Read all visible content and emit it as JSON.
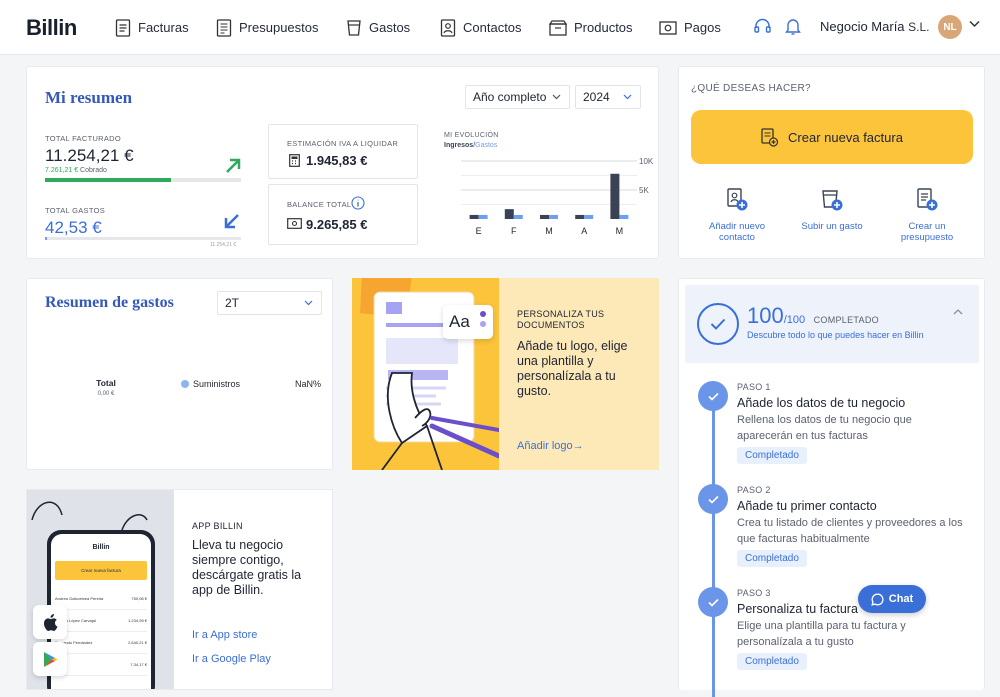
{
  "topbar": {
    "logo": "Billin",
    "nav": [
      "Facturas",
      "Presupuestos",
      "Gastos",
      "Contactos",
      "Productos",
      "Pagos"
    ],
    "company": "Negocio María",
    "company_suffix": "S.L.",
    "avatar": "NL",
    "icons": [
      "headset-icon",
      "bell-icon",
      "chevron-down-icon"
    ]
  },
  "summary": {
    "title": "Mi resumen",
    "period_select": "Año completo",
    "year_select": "2024",
    "total_facturado_label": "TOTAL FACTURADO",
    "total_facturado": "11.254,21 €",
    "cobrado_amount": "7.261,21 €",
    "cobrado_label": "Cobrado",
    "cobrado_fraction": 0.645,
    "total_gastos_label": "TOTAL GASTOS",
    "total_gastos": "42,53 €",
    "gastos_small": "11.254,21 €",
    "iva_label": "ESTIMACIÓN IVA A LIQUIDAR",
    "iva": "1.945,83 €",
    "balance_label": "BALANCE TOTAL",
    "balance": "9.265,85 €",
    "evolucion_label": "MI EVOLUCIÓN",
    "ingresos_label": "Ingresos",
    "gastos_legend": "Gastos"
  },
  "chart_data": {
    "type": "bar",
    "categories": [
      "E",
      "F",
      "M",
      "A",
      "M"
    ],
    "y_ticks": [
      "10K",
      "5K"
    ],
    "ylim": [
      0,
      10000
    ],
    "series": [
      {
        "name": "Ingresos",
        "color": "#3a4356",
        "values": [
          700,
          1700,
          700,
          700,
          7800
        ]
      },
      {
        "name": "Gastos",
        "color": "#6f9ff0",
        "values": [
          700,
          700,
          700,
          700,
          700
        ]
      }
    ]
  },
  "actions": {
    "heading": "¿QUÉ DESEAS HACER?",
    "primary": "Crear nueva factura",
    "quick": [
      {
        "line1": "Añadir nuevo",
        "line2": "contacto"
      },
      {
        "line1": "Subir un gasto",
        "line2": ""
      },
      {
        "line1": "Crear un",
        "line2": "presupuesto"
      }
    ]
  },
  "gastos": {
    "title": "Resumen de gastos",
    "select": "2T",
    "total_label": "Total",
    "total_value": "0,00 €",
    "legend": "Suministros",
    "legend_value": "NaN%"
  },
  "personaliza": {
    "heading1": "PERSONALIZA TUS",
    "heading2": "DOCUMENTOS",
    "lines": [
      "Añade tu logo, elige",
      "una plantilla y",
      "personalízala a tu",
      "gusto."
    ],
    "link": "Añadir logo→",
    "illustration_text": "Aa"
  },
  "app": {
    "heading": "APP BILLIN",
    "lines": [
      "Lleva tu negocio",
      "siempre contigo,",
      "descárgate gratis la",
      "app de Billin."
    ],
    "appstore": "Ir a App store",
    "googleplay": "Ir a Google Play",
    "phone": {
      "brand": "Billin",
      "button": "Crear nueva factura",
      "rows": [
        {
          "name": "Andrea Goikoetxea Pereira",
          "amount": "750,08 €"
        },
        {
          "name": "Sandra López Carvajal",
          "amount": "1.234,95 €"
        },
        {
          "name": "Fernando Fernández",
          "amount": "2.640,21 €"
        },
        {
          "name": "",
          "amount": "7.34,17 €"
        }
      ]
    }
  },
  "progress": {
    "value": "100",
    "suffix": "/100",
    "status": "COMPLETADO",
    "subtitle": "Descubre todo lo que puedes hacer en Billin",
    "steps": [
      {
        "label": "PASO 1",
        "title": "Añade los datos de tu negocio",
        "desc1": "Rellena los datos de tu negocio que",
        "desc2": "aparecerán en tus facturas",
        "badge": "Completado"
      },
      {
        "label": "PASO 2",
        "title": "Añade tu primer contacto",
        "desc1": "Crea tu listado de clientes y proveedores a los",
        "desc2": "que facturas habitualmente",
        "badge": "Completado"
      },
      {
        "label": "PASO 3",
        "title": "Personaliza tu factura",
        "desc1": "Elige una plantilla para tu factura y",
        "desc2": "personalízala a tu gusto",
        "badge": "Completado"
      }
    ]
  },
  "chat": {
    "label": "Chat"
  }
}
